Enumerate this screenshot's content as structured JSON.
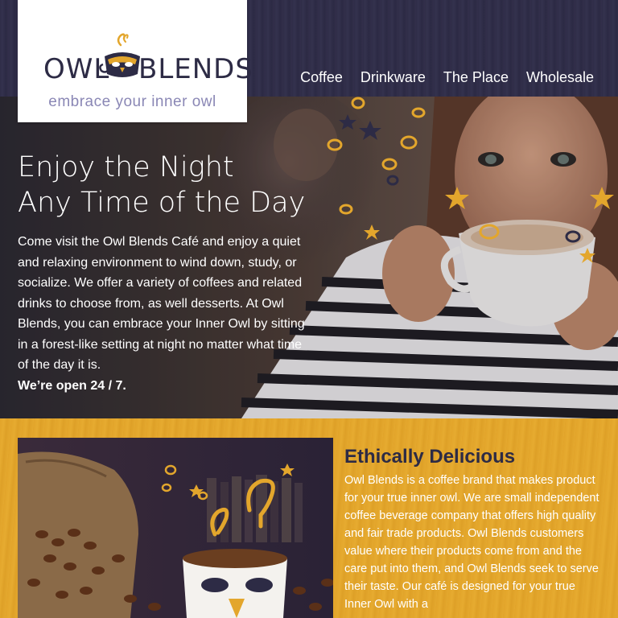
{
  "brand": {
    "name_left": "OWL",
    "name_right": "BLENDS",
    "tagline": "embrace your inner owl",
    "colors": {
      "navy": "#2d2b45",
      "gold": "#e3a62c",
      "lavender": "#8a87b5"
    }
  },
  "nav": {
    "items": [
      {
        "label": "Coffee"
      },
      {
        "label": "Drinkware"
      },
      {
        "label": "The Place"
      },
      {
        "label": "Wholesale"
      }
    ]
  },
  "hero": {
    "title_line1": "Enjoy the Night",
    "title_line2": "Any Time of the Day",
    "body": "Come visit the Owl Blends Café and enjoy a quiet and relaxing environment to wind down, study, or socialize. We offer a variety of coffees and related drinks to choose from, as well desserts. At Owl Blends, you can embrace your Inner Owl by sitting in a forest-like setting at night no matter what time of the day it is.",
    "emphasis": "We’re open 24 / 7."
  },
  "about": {
    "title": "Ethically Delicious",
    "body": "Owl Blends is a coffee brand that makes product for your true inner owl. We are small independent coffee beverage company that offers high quality and fair trade products. Owl Blends customers value where their products come from and the care put into them, and Owl Blends seek to serve their taste. Our café is designed for your true Inner Owl  with a"
  }
}
